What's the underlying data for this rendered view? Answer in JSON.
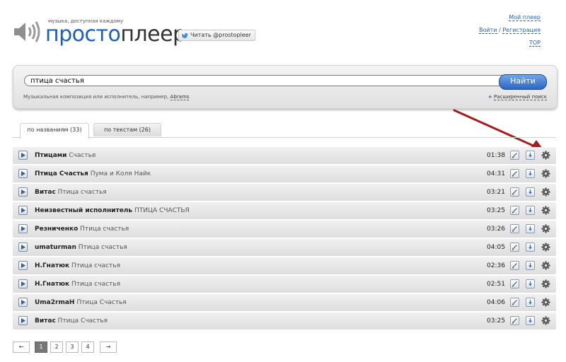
{
  "header": {
    "tagline": "музыка, доступная каждому",
    "brand_part1": "просто",
    "brand_part2": "плеер",
    "twitter_label": "Читать @prostopleer",
    "my_player": "Мой плеер",
    "login": "Войти",
    "separator": "/",
    "register": "Регистрация",
    "top": "TOP"
  },
  "search": {
    "query": "птица счастья",
    "button": "Найти",
    "hint": "Музыкальная композиция или исполнитель, например,",
    "hint_example": "Abrams",
    "advanced_plus": "+",
    "advanced": "Расширенный поиск"
  },
  "tabs": [
    {
      "label": "по названиям (33)",
      "active": true
    },
    {
      "label": "по текстам (26)",
      "active": false
    }
  ],
  "tracks": [
    {
      "artist": "Птицами",
      "title": "Счастье",
      "duration": "01:38"
    },
    {
      "artist": "Птица Счастья",
      "title": "Пума и Коля Найк",
      "duration": "04:31"
    },
    {
      "artist": "Витас",
      "title": "Птица счастья",
      "duration": "03:21"
    },
    {
      "artist": "Неизвестный исполнитель",
      "title": "ПТИЦА СЧАСТЬЯ",
      "duration": "03:25"
    },
    {
      "artist": "Резниченко",
      "title": "Птица счастья",
      "duration": "03:26"
    },
    {
      "artist": "umaturman",
      "title": "Птица счастья",
      "duration": "04:05"
    },
    {
      "artist": "Н.Гнатюк",
      "title": "Птица счастья",
      "duration": "02:36"
    },
    {
      "artist": "Н.Гнатюк",
      "title": "Птица счастья",
      "duration": "02:51"
    },
    {
      "artist": "Uma2rmaH",
      "title": "Птица Счастья",
      "duration": "04:06"
    },
    {
      "artist": "Витас",
      "title": "Птица Счастья",
      "duration": "03:25"
    }
  ],
  "pagination": {
    "prev": "←",
    "pages": [
      "1",
      "2",
      "3",
      "4"
    ],
    "current": "1",
    "next": "→"
  },
  "colors": {
    "brand_blue": "#1d5fb0",
    "button_blue": "#3a74cc",
    "annotation_arrow": "#a31e1e"
  },
  "icons": {
    "speaker": "speaker-icon",
    "twitter": "twitter-bird-icon",
    "play": "play-icon",
    "edit": "edit-icon",
    "download": "download-icon",
    "gear": "gear-icon",
    "annotation": "red-arrow-icon"
  }
}
